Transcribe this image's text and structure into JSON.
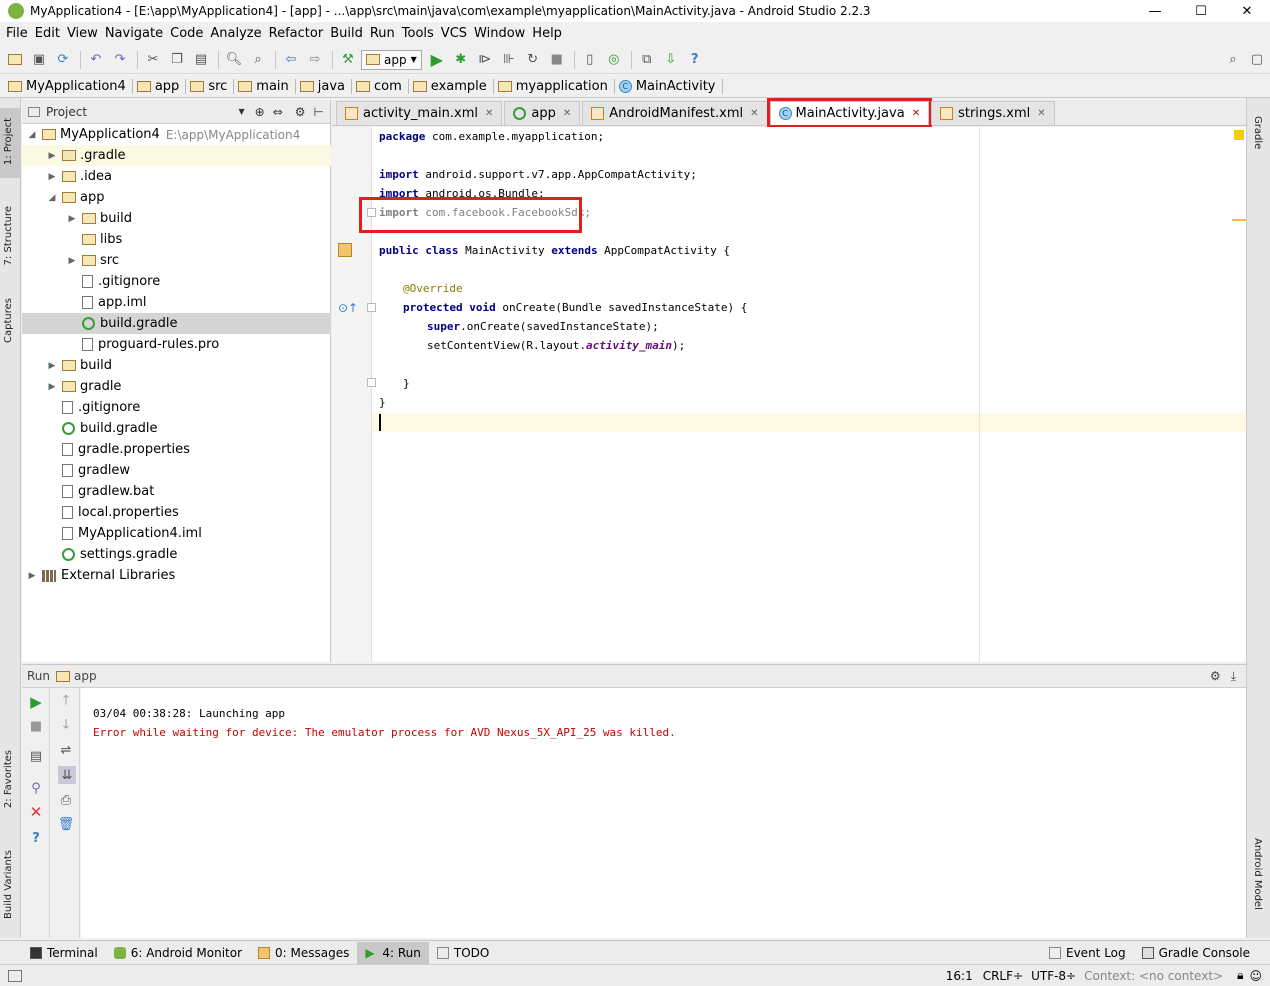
{
  "window": {
    "title": "MyApplication4 - [E:\\app\\MyApplication4] - [app] - ...\\app\\src\\main\\java\\com\\example\\myapplication\\MainActivity.java - Android Studio 2.2.3",
    "minimize": "—",
    "maximize": "☐",
    "close": "✕"
  },
  "menu": [
    "File",
    "Edit",
    "View",
    "Navigate",
    "Code",
    "Analyze",
    "Refactor",
    "Build",
    "Run",
    "Tools",
    "VCS",
    "Window",
    "Help"
  ],
  "toolbar": {
    "run_config": "app"
  },
  "breadcrumb": [
    "MyApplication4",
    "app",
    "src",
    "main",
    "java",
    "com",
    "example",
    "myapplication",
    "MainActivity"
  ],
  "left_strip": {
    "project": "1: Project",
    "structure": "7: Structure",
    "captures": "Captures",
    "favorites": "2: Favorites",
    "build_variants": "Build Variants"
  },
  "right_strip": {
    "gradle": "Gradle",
    "android_model": "Android Model"
  },
  "project_panel": {
    "header": "Project",
    "root": "MyApplication4",
    "root_path": "E:\\app\\MyApplication4",
    "items": [
      {
        "label": ".gradle",
        "type": "folder",
        "depth": 1,
        "arrow": "▶"
      },
      {
        "label": ".idea",
        "type": "folder",
        "depth": 1,
        "arrow": "▶"
      },
      {
        "label": "app",
        "type": "folder",
        "depth": 1,
        "arrow": "◢"
      },
      {
        "label": "build",
        "type": "folder",
        "depth": 2,
        "arrow": "▶"
      },
      {
        "label": "libs",
        "type": "folder",
        "depth": 2,
        "arrow": ""
      },
      {
        "label": "src",
        "type": "folder",
        "depth": 2,
        "arrow": "▶"
      },
      {
        "label": ".gitignore",
        "type": "file",
        "depth": 2,
        "arrow": ""
      },
      {
        "label": "app.iml",
        "type": "file",
        "depth": 2,
        "arrow": ""
      },
      {
        "label": "build.gradle",
        "type": "gradle",
        "depth": 2,
        "arrow": ""
      },
      {
        "label": "proguard-rules.pro",
        "type": "file",
        "depth": 2,
        "arrow": ""
      },
      {
        "label": "build",
        "type": "folder",
        "depth": 1,
        "arrow": "▶"
      },
      {
        "label": "gradle",
        "type": "folder",
        "depth": 1,
        "arrow": "▶"
      },
      {
        "label": ".gitignore",
        "type": "file",
        "depth": 1,
        "arrow": ""
      },
      {
        "label": "build.gradle",
        "type": "gradle",
        "depth": 1,
        "arrow": ""
      },
      {
        "label": "gradle.properties",
        "type": "file",
        "depth": 1,
        "arrow": ""
      },
      {
        "label": "gradlew",
        "type": "file",
        "depth": 1,
        "arrow": ""
      },
      {
        "label": "gradlew.bat",
        "type": "file",
        "depth": 1,
        "arrow": ""
      },
      {
        "label": "local.properties",
        "type": "file",
        "depth": 1,
        "arrow": ""
      },
      {
        "label": "MyApplication4.iml",
        "type": "file",
        "depth": 1,
        "arrow": ""
      },
      {
        "label": "settings.gradle",
        "type": "gradle",
        "depth": 1,
        "arrow": ""
      },
      {
        "label": "External Libraries",
        "type": "lib",
        "depth": 0,
        "arrow": "▶"
      }
    ]
  },
  "tabs": [
    {
      "label": "activity_main.xml",
      "icon": "xml"
    },
    {
      "label": "app",
      "icon": "gradle"
    },
    {
      "label": "AndroidManifest.xml",
      "icon": "xml"
    },
    {
      "label": "MainActivity.java",
      "icon": "class",
      "active": true
    },
    {
      "label": "strings.xml",
      "icon": "xml"
    }
  ],
  "code": {
    "line_package_kw": "package",
    "line_package": " com.example.myapplication;",
    "import_kw": "import",
    "import1": " android.support.v7.app.AppCompatActivity;",
    "import2": " android.os.Bundle;",
    "import3": " com.facebook.FacebookSdk;",
    "public_kw": "public class",
    "class_name": " MainActivity ",
    "extends_kw": "extends",
    "extends_rest": " AppCompatActivity {",
    "override": "@Override",
    "protected_kw": "protected void",
    "oncreate": " onCreate(Bundle savedInstanceState) {",
    "super_kw": "super",
    "super_rest": ".onCreate(savedInstanceState);",
    "setcontent": "setContentView(R.layout.",
    "activity_main": "activity_main",
    "setcontent_end": ");",
    "close_method": "}",
    "close_class": "}"
  },
  "run_panel": {
    "label": "Run",
    "config": "app",
    "lines": [
      {
        "text": "03/04 00:38:28: Launching app",
        "color": "#000000"
      },
      {
        "text": "Error while waiting for device: The emulator process for AVD Nexus_5X_API_25 was killed.",
        "color": "#cc0000"
      }
    ]
  },
  "tool_windows": [
    {
      "label": "Terminal"
    },
    {
      "label": "6: Android Monitor"
    },
    {
      "label": "0: Messages"
    },
    {
      "label": "4: Run",
      "active": true
    },
    {
      "label": "TODO"
    }
  ],
  "tool_windows_right": [
    {
      "label": "Event Log"
    },
    {
      "label": "Gradle Console"
    }
  ],
  "status": {
    "position": "16:1",
    "line_sep": "CRLF÷",
    "encoding": "UTF-8÷",
    "context": "Context: <no context>"
  },
  "colors": {
    "highlight_red": "#e0201c",
    "error_text": "#cc0000",
    "keyword": "#000080"
  }
}
